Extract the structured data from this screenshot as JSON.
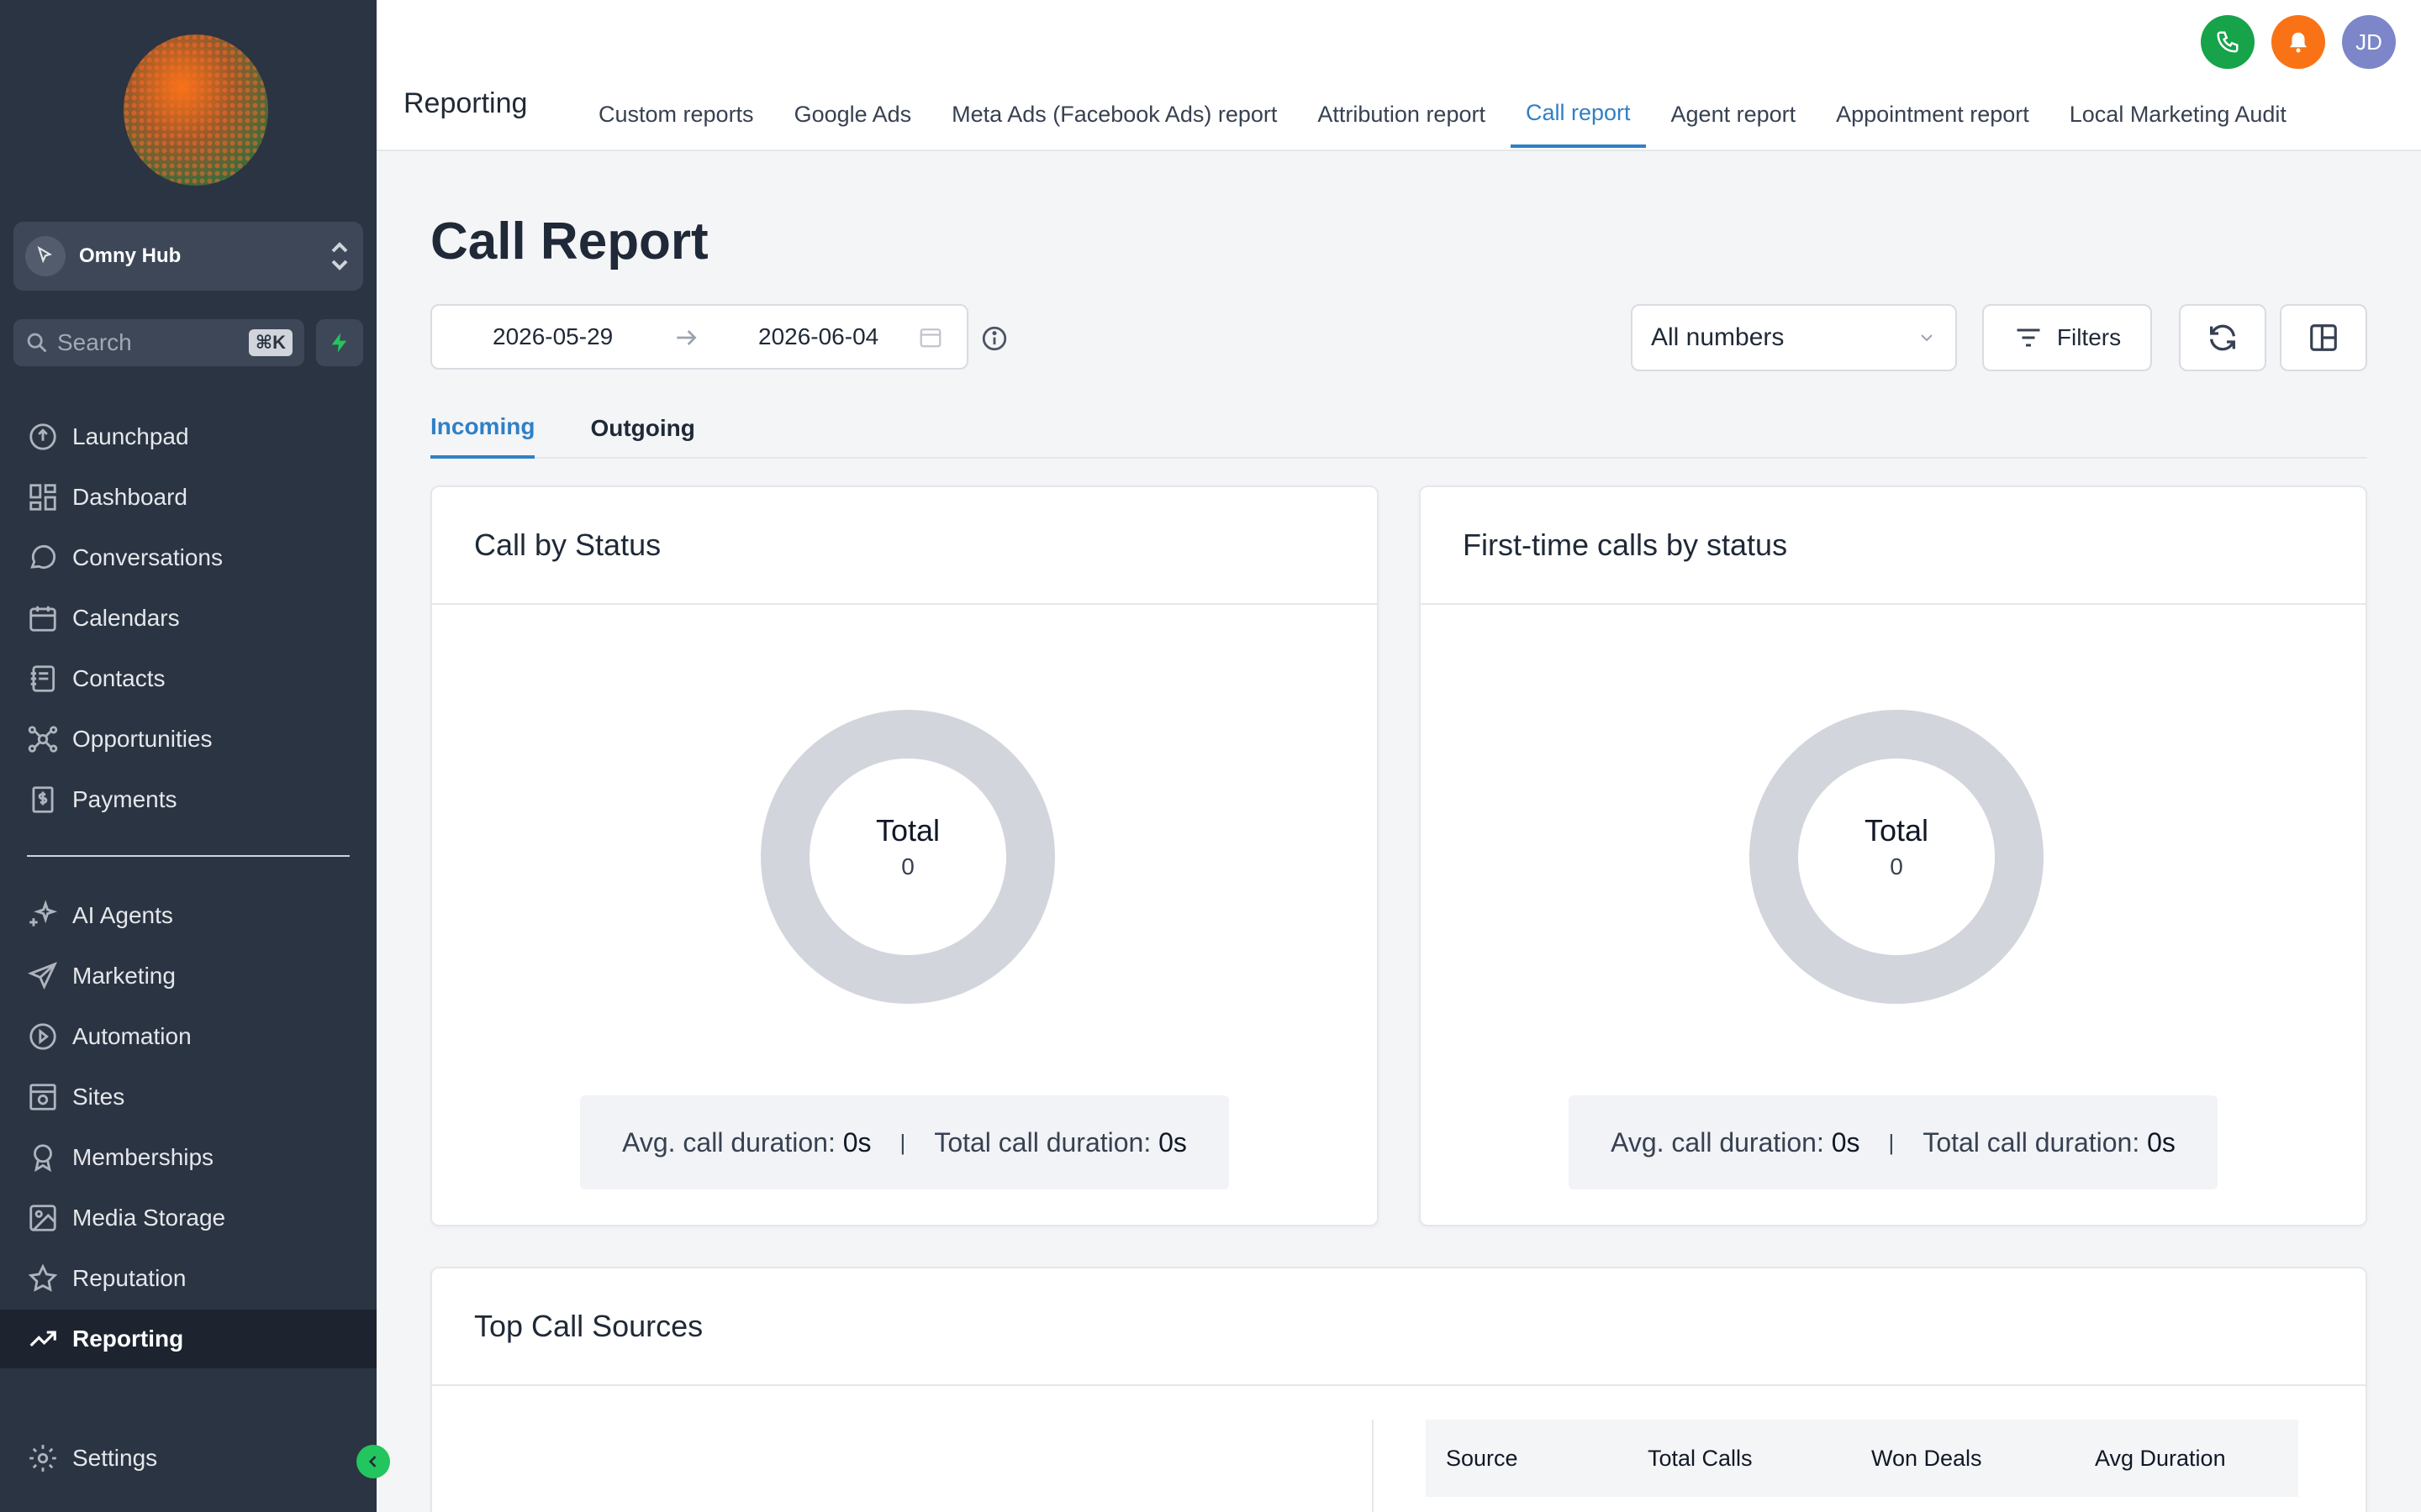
{
  "sidebar": {
    "account_name": "Omny Hub",
    "search_placeholder": "Search",
    "search_shortcut": "⌘K",
    "items": [
      {
        "label": "Launchpad",
        "icon": "launchpad-icon"
      },
      {
        "label": "Dashboard",
        "icon": "dashboard-icon"
      },
      {
        "label": "Conversations",
        "icon": "chat-icon"
      },
      {
        "label": "Calendars",
        "icon": "calendar-icon"
      },
      {
        "label": "Contacts",
        "icon": "contacts-icon"
      },
      {
        "label": "Opportunities",
        "icon": "opportunities-icon"
      },
      {
        "label": "Payments",
        "icon": "payments-icon"
      },
      {
        "label": "AI Agents",
        "icon": "sparkle-icon"
      },
      {
        "label": "Marketing",
        "icon": "send-icon"
      },
      {
        "label": "Automation",
        "icon": "automation-icon"
      },
      {
        "label": "Sites",
        "icon": "sites-icon"
      },
      {
        "label": "Memberships",
        "icon": "award-icon"
      },
      {
        "label": "Media Storage",
        "icon": "image-icon"
      },
      {
        "label": "Reputation",
        "icon": "star-icon"
      },
      {
        "label": "Reporting",
        "icon": "trending-icon"
      },
      {
        "label": "Settings",
        "icon": "gear-icon"
      }
    ],
    "active_item": "Reporting"
  },
  "topbar": {
    "avatar_initials": "JD",
    "section_title": "Reporting",
    "tabs": [
      "Custom reports",
      "Google Ads",
      "Meta Ads (Facebook Ads) report",
      "Attribution report",
      "Call report",
      "Agent report",
      "Appointment report",
      "Local Marketing Audit"
    ],
    "active_tab": "Call report"
  },
  "page": {
    "title": "Call Report",
    "date_start": "2026-05-29",
    "date_end": "2026-06-04",
    "number_select": "All numbers",
    "filters_label": "Filters",
    "subtabs": [
      "Incoming",
      "Outgoing"
    ],
    "active_subtab": "Incoming"
  },
  "cards": {
    "status": {
      "title": "Call by Status",
      "total_label": "Total",
      "total_value": "0",
      "avg_label": "Avg. call duration:",
      "avg_value": "0s",
      "sep": "|",
      "total_dur_label": "Total call duration:",
      "total_dur_value": "0s"
    },
    "first_time": {
      "title": "First-time calls by status",
      "total_label": "Total",
      "total_value": "0",
      "avg_label": "Avg. call duration:",
      "avg_value": "0s",
      "sep": "|",
      "total_dur_label": "Total call duration:",
      "total_dur_value": "0s"
    },
    "sources": {
      "title": "Top Call Sources",
      "columns": [
        "Source",
        "Total Calls",
        "Won Deals",
        "Avg Duration"
      ]
    }
  },
  "colors": {
    "sidebar_bg": "#2b3442",
    "accent_blue": "#2f80c6",
    "phone_green": "#16a34a",
    "bell_orange": "#f97316",
    "avatar_purple": "#7c86c9",
    "donut_gray": "#d2d5db"
  }
}
